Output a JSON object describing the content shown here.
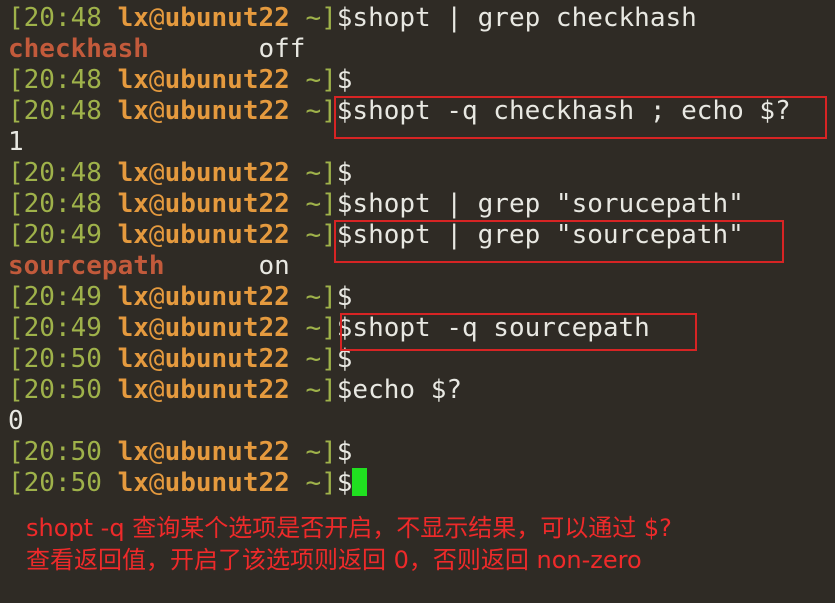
{
  "prompt": {
    "user": "lx",
    "at": "@",
    "host": "ubunut22",
    "dir": "~"
  },
  "lines": [
    {
      "type": "prompt",
      "time": "20:48",
      "cmd": "shopt | grep checkhash"
    },
    {
      "type": "output",
      "name": "checkhash",
      "value": "off"
    },
    {
      "type": "prompt",
      "time": "20:48",
      "cmd": ""
    },
    {
      "type": "prompt",
      "time": "20:48",
      "cmd": "shopt -q checkhash ; echo $?"
    },
    {
      "type": "plain",
      "text": "1"
    },
    {
      "type": "prompt",
      "time": "20:48",
      "cmd": ""
    },
    {
      "type": "prompt",
      "time": "20:48",
      "cmd": "shopt | grep \"sorucepath\""
    },
    {
      "type": "prompt",
      "time": "20:49",
      "cmd": "shopt | grep \"sourcepath\""
    },
    {
      "type": "output",
      "name": "sourcepath",
      "value": "on"
    },
    {
      "type": "prompt",
      "time": "20:49",
      "cmd": ""
    },
    {
      "type": "prompt",
      "time": "20:49",
      "cmd": "shopt -q sourcepath"
    },
    {
      "type": "prompt",
      "time": "20:50",
      "cmd": ""
    },
    {
      "type": "prompt",
      "time": "20:50",
      "cmd": "echo $?"
    },
    {
      "type": "plain",
      "text": "0"
    },
    {
      "type": "prompt",
      "time": "20:50",
      "cmd": ""
    },
    {
      "type": "prompt",
      "time": "20:50",
      "cmd": "",
      "cursor": true
    }
  ],
  "annotation": {
    "line1": "shopt -q 查询某个选项是否开启，不显示结果，可以通过 $?",
    "line2": "查看返回值，开启了该选项则返回 0，否则返回 non-zero"
  },
  "colors": {
    "background": "#2f2b25",
    "prompt_green": "#9fb24a",
    "prompt_orange": "#e59a3e",
    "option_name": "#c25a3b",
    "highlight_box": "#d72424",
    "annotation_text": "#ee2a2a",
    "cursor": "#20e020"
  }
}
